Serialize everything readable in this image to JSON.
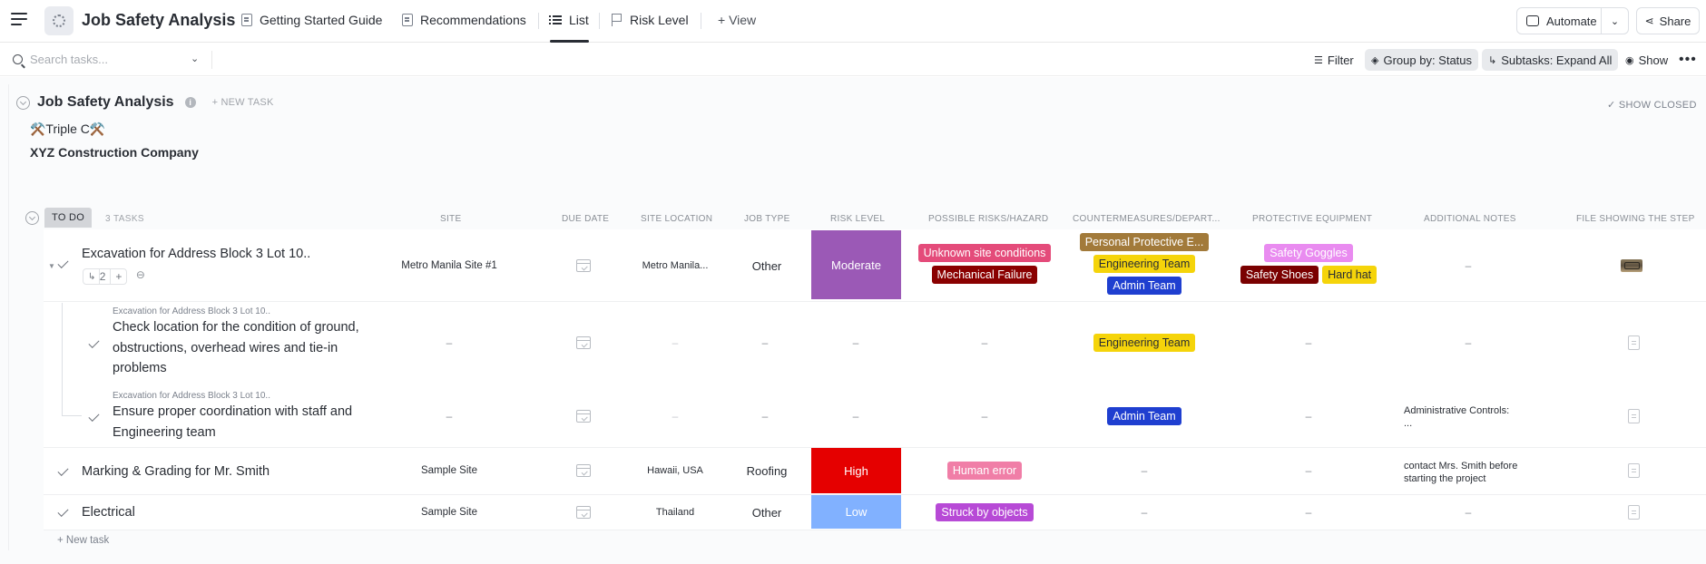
{
  "header": {
    "title": "Job Safety Analysis",
    "tabs": [
      {
        "label": "Getting Started Guide",
        "icon": "doc-icon"
      },
      {
        "label": "Recommendations",
        "icon": "doc-icon"
      },
      {
        "label": "List",
        "icon": "list-icon",
        "active": true
      },
      {
        "label": "Risk Level",
        "icon": "flag-icon"
      }
    ],
    "add_view": "+ View",
    "automate": "Automate",
    "share": "Share"
  },
  "toolbar": {
    "search_placeholder": "Search tasks...",
    "filter": "Filter",
    "group_by": "Group by: Status",
    "subtasks": "Subtasks: Expand All",
    "show": "Show"
  },
  "list": {
    "name": "Job Safety Analysis",
    "new_task": "+ NEW TASK",
    "show_closed": "✓ SHOW CLOSED",
    "description_line1": "⚒️Triple C⚒️",
    "description_line2": "XYZ Construction Company",
    "status": "TO DO",
    "task_count": "3 TASKS",
    "columns": [
      "SITE",
      "DUE DATE",
      "SITE LOCATION",
      "JOB TYPE",
      "RISK LEVEL",
      "POSSIBLE RISKS/HAZARD",
      "COUNTERMEASURES/DEPART...",
      "PROTECTIVE EQUIPMENT",
      "ADDITIONAL NOTES",
      "FILE SHOWING THE STEP"
    ],
    "add_task": "+ New task"
  },
  "tasks": [
    {
      "name": "Excavation for Address Block 3 Lot 10..",
      "subtask_count": "2",
      "site": "Metro Manila Site #1",
      "location": "Metro Manila...",
      "job_type": "Other",
      "risk": "Moderate",
      "hazards": [
        "Unknown site conditions",
        "Mechanical Failure"
      ],
      "countermeasures": [
        "Personal Protective E...",
        "Engineering Team",
        "Admin Team"
      ],
      "equipment": [
        "Safety Goggles",
        "Safety Shoes",
        "Hard hat"
      ],
      "notes": "–"
    },
    {
      "parent": "Excavation for Address Block 3 Lot 10..",
      "name": "Check location for the condition of ground, obstructions, overhead wires and tie-in problems",
      "site": "–",
      "location": "–",
      "job_type": "–",
      "risk": "–",
      "hazards": "–",
      "countermeasures": [
        "Engineering Team"
      ],
      "equipment": "–",
      "notes": "–"
    },
    {
      "parent": "Excavation for Address Block 3 Lot 10..",
      "name": "Ensure proper coordination with staff and Engineering team",
      "site": "–",
      "location": "–",
      "job_type": "–",
      "risk": "–",
      "hazards": "–",
      "countermeasures": [
        "Admin Team"
      ],
      "equipment": "–",
      "notes_line1": "Administrative Controls:",
      "notes_line2": "..."
    },
    {
      "name": "Marking & Grading for Mr. Smith",
      "site": "Sample Site",
      "location": "Hawaii, USA",
      "job_type": "Roofing",
      "risk": "High",
      "hazards": [
        "Human error"
      ],
      "countermeasures": "–",
      "equipment": "–",
      "notes_line1": "contact Mrs. Smith before",
      "notes_line2": "starting the project"
    },
    {
      "name": "Electrical",
      "site": "Sample Site",
      "location": "Thailand",
      "job_type": "Other",
      "risk": "Low",
      "hazards": [
        "Struck by objects"
      ],
      "countermeasures": "–",
      "equipment": "–",
      "notes": "–"
    }
  ],
  "colors": {
    "moderate": "#9b59b6",
    "high": "#e50000",
    "low": "#81b1ff",
    "unknown_site": "#e44b7a",
    "mechanical": "#8a0000",
    "ppe": "#a27a3a",
    "engineering": "#f5d40a",
    "admin": "#1f3fd0",
    "goggles": "#e98bf0",
    "shoes": "#7a0000",
    "hardhat": "#f5d40a",
    "human_error": "#f07ea7",
    "struck": "#b74ad6"
  }
}
